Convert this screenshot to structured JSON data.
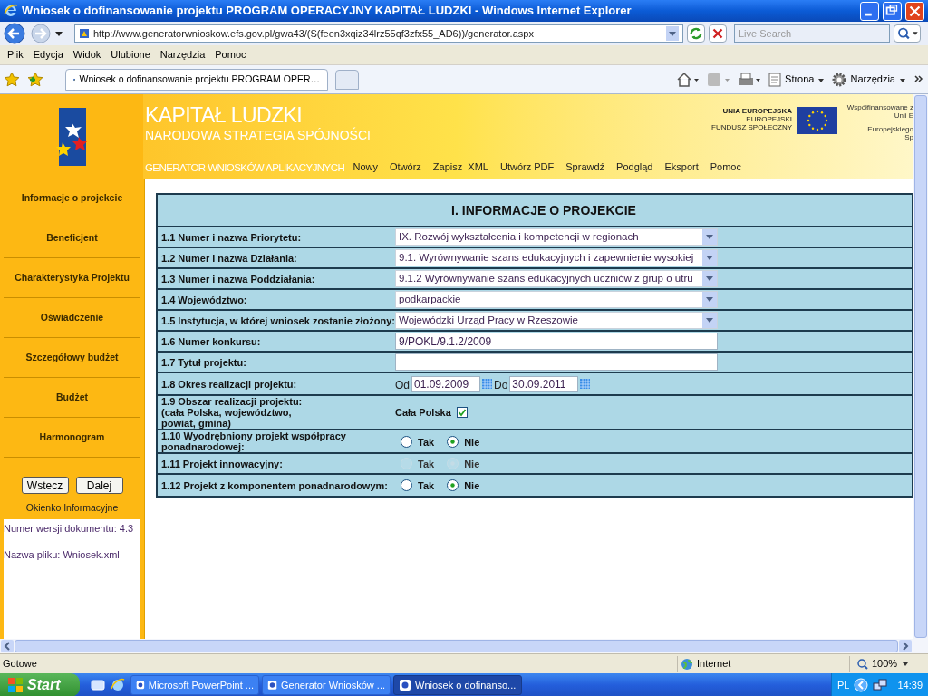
{
  "window": {
    "title": "Wniosek o dofinansowanie projektu PROGRAM OPERACYJNY KAPITAŁ LUDZKI - Windows Internet Explorer"
  },
  "address_bar": {
    "url": "http://www.generatorwnioskow.efs.gov.pl/gwa43/(S(feen3xqiz34lrz55qf3zfx55_AD6))/generator.aspx"
  },
  "search": {
    "placeholder": "Live Search"
  },
  "menu": [
    "Plik",
    "Edycja",
    "Widok",
    "Ulubione",
    "Narzędzia",
    "Pomoc"
  ],
  "tabs": [
    {
      "label": "Wniosek o dofinansowanie projektu PROGRAM OPER…",
      "selected": true
    }
  ],
  "command_bar": [
    "Strona",
    "Narzędzia"
  ],
  "header": {
    "title": "KAPITAŁ LUDZKI",
    "subtitle": "NARODOWA STRATEGIA SPÓJNOŚCI",
    "generator": "GENERATOR WNIOSKÓW APLIKACYJNYCH",
    "nav": [
      "Nowy",
      "Otwórz",
      "Zapisz  XML",
      "Utwórz PDF",
      "Sprawdź",
      "Podgląd",
      "Eksport",
      "Pomoc"
    ],
    "eu_lines": [
      "UNIA EUROPEJSKA",
      "EUROPEJSKI",
      "FUNDUSZ SPOŁECZNY"
    ],
    "cofinance_lines": [
      "Współfinansowane z",
      "Unii E",
      "Europejskiego",
      "Sp"
    ]
  },
  "sidebar": {
    "items": [
      "Informacje o projekcie",
      "Beneficjent",
      "Charakterystyka Projektu",
      "Oświadczenie",
      "Szczegółowy budżet",
      "Budżet",
      "Harmonogram"
    ],
    "buttons": [
      "Wstecz",
      "Dalej"
    ],
    "info_title": "Okienko Informacyjne",
    "info_lines": [
      "Numer wersji dokumentu: 4.3",
      "Nazwa pliku: Wniosek.xml"
    ]
  },
  "form": {
    "title": "I. INFORMACJE O PROJEKCIE",
    "rows": [
      {
        "label": "1.1 Numer i nazwa Priorytetu:",
        "kind": "select",
        "value": "IX. Rozwój wykształcenia i kompetencji w regionach"
      },
      {
        "label": "1.2 Numer i nazwa Działania:",
        "kind": "select",
        "value": "9.1. Wyrównywanie szans edukacyjnych i zapewnienie wysokiej"
      },
      {
        "label": "1.3 Numer i nazwa Poddziałania:",
        "kind": "select",
        "value": "9.1.2 Wyrównywanie szans edukacyjnych uczniów z grup o utru"
      },
      {
        "label": "1.4 Województwo:",
        "kind": "select",
        "value": "podkarpackie"
      },
      {
        "label": "1.5 Instytucja, w której wniosek zostanie złożony:",
        "kind": "select",
        "value": "Wojewódzki Urząd Pracy w Rzeszowie"
      },
      {
        "label": "1.6 Numer konkursu:",
        "kind": "text",
        "value": "9/POKL/9.1.2/2009"
      },
      {
        "label": "1.7 Tytuł projektu:",
        "kind": "text"
      },
      {
        "label": "1.8 Okres realizacji projektu:",
        "kind": "daterange",
        "from_label": "Od",
        "from": "01.09.2009",
        "to_label": "Do",
        "to": "30.09.2011"
      },
      {
        "label": "1.9 Obszar realizacji projektu:\n(cała Polska, województwo,\npowiat, gmina)",
        "kind": "checkbox",
        "option": "Cała Polska",
        "checked": true
      },
      {
        "label": "1.10 Wyodrębniony projekt współpracy\nponadnarodowej:",
        "kind": "radio",
        "disabled": false,
        "options": [
          {
            "label": "Tak",
            "selected": false
          },
          {
            "label": "Nie",
            "selected": true
          }
        ]
      },
      {
        "label": "1.11 Projekt innowacyjny:",
        "kind": "radio",
        "disabled": true,
        "options": [
          {
            "label": "Tak",
            "selected": false
          },
          {
            "label": "Nie",
            "selected": true
          }
        ]
      },
      {
        "label": "1.12 Projekt z komponentem ponadnarodowym:",
        "kind": "radio",
        "disabled": false,
        "options": [
          {
            "label": "Tak",
            "selected": false
          },
          {
            "label": "Nie",
            "selected": true
          }
        ]
      }
    ]
  },
  "status_bar": {
    "text": "Gotowe",
    "zone": "Internet",
    "zoom": "100%"
  },
  "taskbar": {
    "start": "Start",
    "tasks": [
      {
        "label": "Microsoft PowerPoint ...",
        "selected": false
      },
      {
        "label": "Generator Wniosków ...",
        "selected": false
      },
      {
        "label": "Wniosek o dofinanso...",
        "selected": true
      }
    ],
    "language": "PL",
    "clock": "14:39"
  }
}
